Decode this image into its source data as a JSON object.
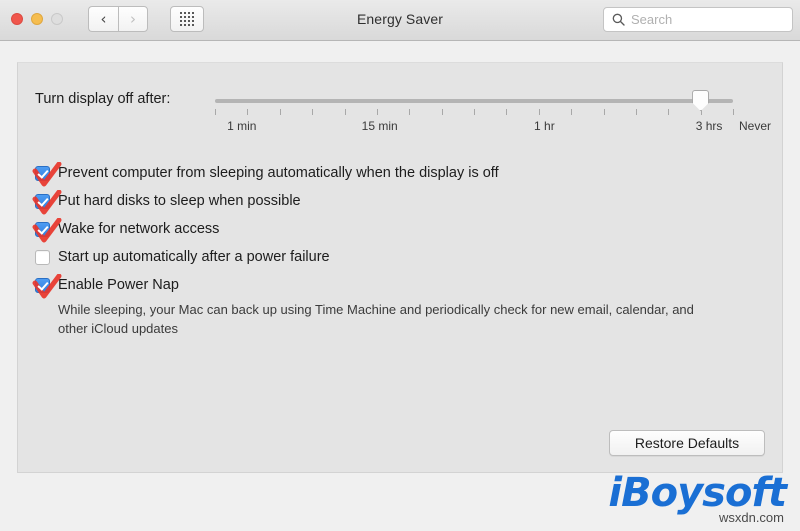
{
  "window": {
    "title": "Energy Saver",
    "traffic_lights": [
      {
        "name": "close",
        "color": "#f0564c"
      },
      {
        "name": "minimize",
        "color": "#f5bd4f"
      },
      {
        "name": "zoom",
        "color": "#dedede"
      }
    ],
    "nav": {
      "back_icon": "chevron-left-icon",
      "back_glyph": "‹",
      "forward_icon": "chevron-right-icon",
      "forward_glyph": "›",
      "grid_icon": "grid-dots-icon"
    },
    "search": {
      "icon": "search-icon",
      "placeholder": "Search",
      "value": ""
    }
  },
  "slider": {
    "label": "Turn display off after:",
    "tick_count": 17,
    "value_index": 15,
    "value_label": "3 hrs",
    "tick_labels": [
      {
        "text": "1 min",
        "pos_pct": 3.5
      },
      {
        "text": "15 min",
        "pos_pct": 21.5
      },
      {
        "text": "1 hr",
        "pos_pct": 43.0
      },
      {
        "text": "3 hrs",
        "pos_pct": 64.5
      },
      {
        "text": "Never",
        "pos_pct": 70.5
      }
    ]
  },
  "options": [
    {
      "label": "Prevent computer from sleeping automatically when the display is off",
      "checked": true,
      "annotated": true,
      "name": "prevent-sleep-checkbox"
    },
    {
      "label": "Put hard disks to sleep when possible",
      "checked": true,
      "annotated": true,
      "name": "hard-disk-sleep-checkbox"
    },
    {
      "label": "Wake for network access",
      "checked": true,
      "annotated": true,
      "name": "wake-network-checkbox"
    },
    {
      "label": "Start up automatically after a power failure",
      "checked": false,
      "annotated": false,
      "name": "startup-after-power-failure-checkbox"
    },
    {
      "label": "Enable Power Nap",
      "checked": true,
      "annotated": true,
      "name": "enable-power-nap-checkbox"
    }
  ],
  "power_nap_note": "While sleeping, your Mac can back up using Time Machine and periodically check for new email, calendar, and other iCloud updates",
  "restore_button": "Restore Defaults",
  "watermark": {
    "logo_i": "i",
    "logo_rest": "Boysoft",
    "sub": "wsxdn.com",
    "color": "#1a6fd4"
  },
  "annotation": {
    "color": "#e8352a"
  }
}
